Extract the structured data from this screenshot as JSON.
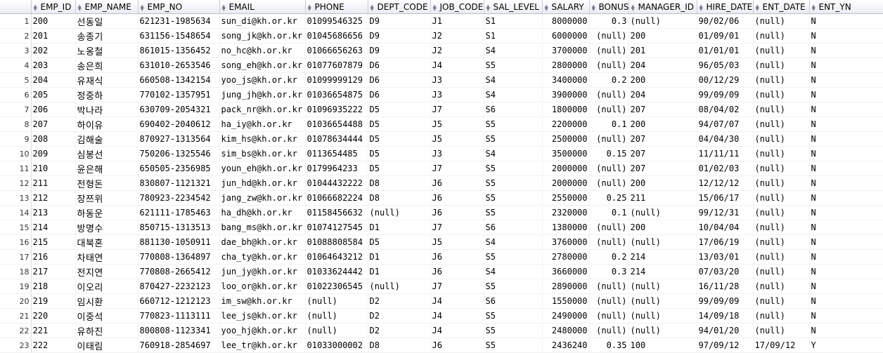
{
  "columns": [
    "",
    "EMP_ID",
    "EMP_NAME",
    "EMP_NO",
    "EMAIL",
    "PHONE",
    "DEPT_CODE",
    "JOB_CODE",
    "SAL_LEVEL",
    "SALARY",
    "BONUS",
    "MANAGER_ID",
    "HIRE_DATE",
    "ENT_DATE",
    "ENT_YN"
  ],
  "rows": [
    [
      "1",
      "200",
      "선동일",
      "621231-1985634",
      "sun_di@kh.or.kr",
      "01099546325",
      "D9",
      "J1",
      "S1",
      "8000000",
      "0.3",
      "(null)",
      "90/02/06",
      "(null)",
      "N"
    ],
    [
      "2",
      "201",
      "송종기",
      "631156-1548654",
      "song_jk@kh.or.kr",
      "01045686656",
      "D9",
      "J2",
      "S1",
      "6000000",
      "(null)",
      "200",
      "01/09/01",
      "(null)",
      "N"
    ],
    [
      "3",
      "202",
      "노옹철",
      "861015-1356452",
      "no_hc@kh.or.kr",
      "01066656263",
      "D9",
      "J2",
      "S4",
      "3700000",
      "(null)",
      "201",
      "01/01/01",
      "(null)",
      "N"
    ],
    [
      "4",
      "203",
      "송은희",
      "631010-2653546",
      "song_eh@kh.or.kr",
      "01077607879",
      "D6",
      "J4",
      "S5",
      "2800000",
      "(null)",
      "204",
      "96/05/03",
      "(null)",
      "N"
    ],
    [
      "5",
      "204",
      "유재식",
      "660508-1342154",
      "yoo_js@kh.or.kr",
      "01099999129",
      "D6",
      "J3",
      "S4",
      "3400000",
      "0.2",
      "200",
      "00/12/29",
      "(null)",
      "N"
    ],
    [
      "6",
      "205",
      "정중하",
      "770102-1357951",
      "jung_jh@kh.or.kr",
      "01036654875",
      "D6",
      "J3",
      "S4",
      "3900000",
      "(null)",
      "204",
      "99/09/09",
      "(null)",
      "N"
    ],
    [
      "7",
      "206",
      "박나라",
      "630709-2054321",
      "pack_nr@kh.or.kr",
      "01096935222",
      "D5",
      "J7",
      "S6",
      "1800000",
      "(null)",
      "207",
      "08/04/02",
      "(null)",
      "N"
    ],
    [
      "8",
      "207",
      "하이유",
      "690402-2040612",
      "ha_iy@kh.or.kr",
      "01036654488",
      "D5",
      "J5",
      "S5",
      "2200000",
      "0.1",
      "200",
      "94/07/07",
      "(null)",
      "N"
    ],
    [
      "9",
      "208",
      "김해술",
      "870927-1313564",
      "kim_hs@kh.or.kr",
      "01078634444",
      "D5",
      "J5",
      "S5",
      "2500000",
      "(null)",
      "207",
      "04/04/30",
      "(null)",
      "N"
    ],
    [
      "10",
      "209",
      "심봉선",
      "750206-1325546",
      "sim_bs@kh.or.kr",
      "0113654485",
      "D5",
      "J3",
      "S4",
      "3500000",
      "0.15",
      "207",
      "11/11/11",
      "(null)",
      "N"
    ],
    [
      "11",
      "210",
      "윤은해",
      "650505-2356985",
      "youn_eh@kh.or.kr",
      "0179964233",
      "D5",
      "J7",
      "S5",
      "2000000",
      "(null)",
      "207",
      "01/02/03",
      "(null)",
      "N"
    ],
    [
      "12",
      "211",
      "전형돈",
      "830807-1121321",
      "jun_hd@kh.or.kr",
      "01044432222",
      "D8",
      "J6",
      "S5",
      "2000000",
      "(null)",
      "200",
      "12/12/12",
      "(null)",
      "N"
    ],
    [
      "13",
      "212",
      "장쯔위",
      "780923-2234542",
      "jang_zw@kh.or.kr",
      "01066682224",
      "D8",
      "J6",
      "S5",
      "2550000",
      "0.25",
      "211",
      "15/06/17",
      "(null)",
      "N"
    ],
    [
      "14",
      "213",
      "하동운",
      "621111-1785463",
      "ha_dh@kh.or.kr",
      "01158456632",
      "(null)",
      "J6",
      "S5",
      "2320000",
      "0.1",
      "(null)",
      "99/12/31",
      "(null)",
      "N"
    ],
    [
      "15",
      "214",
      "방명수",
      "850715-1313513",
      "bang_ms@kh.or.kr",
      "01074127545",
      "D1",
      "J7",
      "S6",
      "1380000",
      "(null)",
      "200",
      "10/04/04",
      "(null)",
      "N"
    ],
    [
      "16",
      "215",
      "대북혼",
      "881130-1050911",
      "dae_bh@kh.or.kr",
      "01088808584",
      "D5",
      "J5",
      "S4",
      "3760000",
      "(null)",
      "(null)",
      "17/06/19",
      "(null)",
      "N"
    ],
    [
      "17",
      "216",
      "차태연",
      "770808-1364897",
      "cha_ty@kh.or.kr",
      "01064643212",
      "D1",
      "J6",
      "S5",
      "2780000",
      "0.2",
      "214",
      "13/03/01",
      "(null)",
      "N"
    ],
    [
      "18",
      "217",
      "전지연",
      "770808-2665412",
      "jun_jy@kh.or.kr",
      "01033624442",
      "D1",
      "J6",
      "S4",
      "3660000",
      "0.3",
      "214",
      "07/03/20",
      "(null)",
      "N"
    ],
    [
      "19",
      "218",
      "이오리",
      "870427-2232123",
      "loo_or@kh.or.kr",
      "01022306545",
      "(null)",
      "J7",
      "S5",
      "2890000",
      "(null)",
      "(null)",
      "16/11/28",
      "(null)",
      "N"
    ],
    [
      "20",
      "219",
      "임시환",
      "660712-1212123",
      "im_sw@kh.or.kr",
      "(null)",
      "D2",
      "J4",
      "S6",
      "1550000",
      "(null)",
      "(null)",
      "99/09/09",
      "(null)",
      "N"
    ],
    [
      "21",
      "220",
      "이중석",
      "770823-1113111",
      "lee_js@kh.or.kr",
      "(null)",
      "D2",
      "J4",
      "S5",
      "2490000",
      "(null)",
      "(null)",
      "14/09/18",
      "(null)",
      "N"
    ],
    [
      "22",
      "221",
      "유하진",
      "800808-1123341",
      "yoo_hj@kh.or.kr",
      "(null)",
      "D2",
      "J4",
      "S5",
      "2480000",
      "(null)",
      "(null)",
      "94/01/20",
      "(null)",
      "N"
    ],
    [
      "23",
      "222",
      "이태림",
      "760918-2854697",
      "lee_tr@kh.or.kr",
      "01033000002",
      "D8",
      "J6",
      "S5",
      "2436240",
      "0.35",
      "100",
      "97/09/12",
      "17/09/12",
      "Y"
    ]
  ]
}
